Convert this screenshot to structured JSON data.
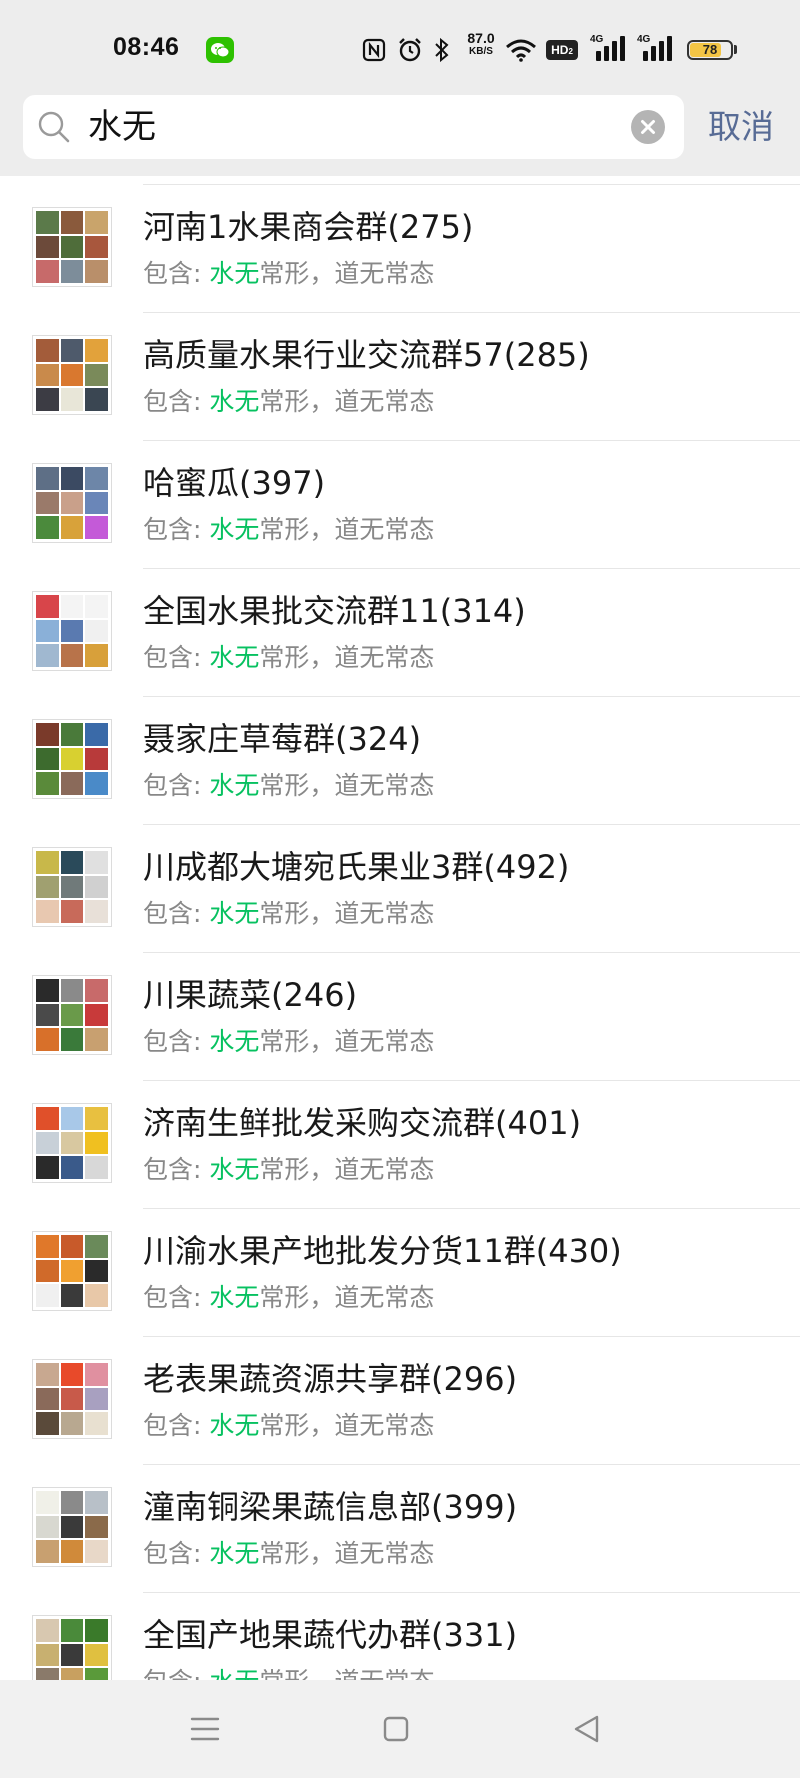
{
  "status_bar": {
    "time": "08:46",
    "wechat_icon": "wechat-notification-icon",
    "icons": [
      "nfc-icon",
      "alarm-icon",
      "bluetooth-icon",
      "wifi-icon"
    ],
    "net_speed_value": "87.0",
    "net_speed_unit": "KB/S",
    "hd_label": "HD",
    "hd_index": "2",
    "signal_1_label": "4G",
    "signal_2_label": "4G",
    "battery_level": "78",
    "battery_percent": 78
  },
  "search": {
    "query": "水无",
    "cancel_label": "取消"
  },
  "colors": {
    "header_bg": "#ededed",
    "highlight_green": "#07c160",
    "cancel_blue": "#576b95",
    "subtitle_grey": "#888888"
  },
  "results": [
    {
      "title": "河南1水果商会群(275)",
      "prefix": "包含: ",
      "match": "水无",
      "rest": "常形，道无常态",
      "avatar_tiles": [
        "#5b7a4a",
        "#8a5a3c",
        "#c9a46b",
        "#6c4a3a",
        "#4f6d3a",
        "#a8573d",
        "#c76a6a",
        "#7d8d9a",
        "#b98f6a"
      ]
    },
    {
      "title": "高质量水果行业交流群57(285)",
      "prefix": "包含: ",
      "match": "水无",
      "rest": "常形，道无常态",
      "avatar_tiles": [
        "#a35c3a",
        "#4e5a6b",
        "#e2a23b",
        "#c98a4b",
        "#d9782f",
        "#7a8a5a",
        "#3c3c44",
        "#e8e6d8",
        "#3a4652"
      ]
    },
    {
      "title": "哈蜜瓜(397)",
      "prefix": "包含: ",
      "match": "水无",
      "rest": "常形，道无常态",
      "avatar_tiles": [
        "#5e6f86",
        "#3b4a62",
        "#6d86a8",
        "#9a7a6a",
        "#c9a08a",
        "#6a86b8",
        "#4b8a3c",
        "#d8a23a",
        "#c45ad8"
      ]
    },
    {
      "title": "全国水果批交流群11(314)",
      "prefix": "包含: ",
      "match": "水无",
      "rest": "常形，道无常态",
      "avatar_tiles": [
        "#d8454a",
        "#f4f4f4",
        "#f4f4f4",
        "#8ab0d8",
        "#5a7ab0",
        "#f0f0f0",
        "#a0b8d0",
        "#b8734a",
        "#d8a03a"
      ]
    },
    {
      "title": "聂家庄草莓群(324)",
      "prefix": "包含: ",
      "match": "水无",
      "rest": "常形，道无常态",
      "avatar_tiles": [
        "#7a3a2a",
        "#4a7a3a",
        "#3a6aa8",
        "#3d6b2e",
        "#d8d030",
        "#b83a3a",
        "#5a8a3a",
        "#8a6a5a",
        "#4a8ac8"
      ]
    },
    {
      "title": "川成都大塘宛氏果业3群(492)",
      "prefix": "包含: ",
      "match": "水无",
      "rest": "常形，道无常态",
      "avatar_tiles": [
        "#c8b84a",
        "#2a4a5a",
        "#e0e0e0",
        "#a0a070",
        "#707a7a",
        "#d0d0d0",
        "#e8c8b0",
        "#c86a5a",
        "#e8e0d8"
      ]
    },
    {
      "title": "川果蔬菜(246)",
      "prefix": "包含: ",
      "match": "水无",
      "rest": "常形，道无常态",
      "avatar_tiles": [
        "#2a2a2a",
        "#8a8a8a",
        "#c86a6a",
        "#4a4a4a",
        "#6a9a4a",
        "#c83a3a",
        "#d8702a",
        "#3a7a3a",
        "#c8a070"
      ]
    },
    {
      "title": "济南生鲜批发采购交流群(401)",
      "prefix": "包含: ",
      "match": "水无",
      "rest": "常形，道无常态",
      "avatar_tiles": [
        "#e0502a",
        "#a8c8e8",
        "#e8c040",
        "#c8d0d8",
        "#d8c8a0",
        "#f0c020",
        "#2a2a2a",
        "#3a5a8a",
        "#d8d8d8"
      ]
    },
    {
      "title": "川渝水果产地批发分货11群(430)",
      "prefix": "包含: ",
      "match": "水无",
      "rest": "常形，道无常态",
      "avatar_tiles": [
        "#e0782a",
        "#c85a2a",
        "#6a8a5a",
        "#d06a2a",
        "#f0a030",
        "#2a2a2a",
        "#f0f0f0",
        "#3a3a3a",
        "#e8c8a8"
      ]
    },
    {
      "title": "老表果蔬资源共享群(296)",
      "prefix": "包含: ",
      "match": "水无",
      "rest": "常形，道无常态",
      "avatar_tiles": [
        "#c8a890",
        "#e84a2a",
        "#e090a0",
        "#8a6a5a",
        "#c85a4a",
        "#a8a0c0",
        "#5a4a3a",
        "#b8a890",
        "#e8e0d0"
      ]
    },
    {
      "title": "潼南铜梁果蔬信息部(399)",
      "prefix": "包含: ",
      "match": "水无",
      "rest": "常形，道无常态",
      "avatar_tiles": [
        "#f0f0e8",
        "#8a8a8a",
        "#b8c0c8",
        "#d8d8d0",
        "#3a3a3a",
        "#8a6a4a",
        "#c8a070",
        "#d08a3a",
        "#e8d8c8"
      ]
    },
    {
      "title": "全国产地果蔬代办群(331)",
      "prefix": "包含: ",
      "match": "水无",
      "rest": "常形，道无常态",
      "avatar_tiles": [
        "#d8c8b0",
        "#4a8a3a",
        "#3a7a2a",
        "#c8b070",
        "#3a3a3a",
        "#e0c040",
        "#8a7a6a",
        "#c8a060",
        "#5a9a3a"
      ]
    }
  ],
  "nav_bar": {
    "icons": [
      "menu-icon",
      "home-square-icon",
      "back-triangle-icon"
    ]
  }
}
